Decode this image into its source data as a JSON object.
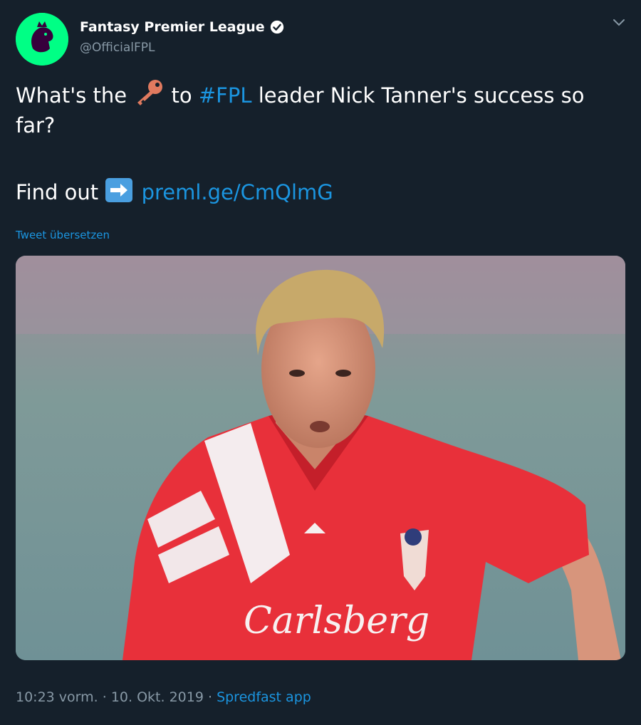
{
  "account": {
    "name": "Fantasy Premier League",
    "handle": "@OfficialFPL",
    "verified": true
  },
  "tweet": {
    "text_before_emoji": "What's the ",
    "emoji": "key-icon",
    "text_after_emoji": " to ",
    "hashtag": "#FPL",
    "text_after_hashtag": " leader Nick Tanner's success so far?",
    "findout_text": "Find out ",
    "findout_emoji": "right-arrow-icon",
    "link": "preml.ge/CmQlmG",
    "translate": "Tweet übersetzen"
  },
  "media": {
    "description_icon": "football-player-photo",
    "shirt_sponsor": "Carlsberg"
  },
  "meta": {
    "time": "10:23 vorm.",
    "sep1": " · ",
    "date": "10. Okt. 2019",
    "sep2": " · ",
    "source": "Spredfast app"
  },
  "colors": {
    "background": "#15202b",
    "link": "#1b95e0",
    "muted": "#8899a6",
    "avatar_bg": "#00ff85",
    "shirt": "#e8303a"
  }
}
